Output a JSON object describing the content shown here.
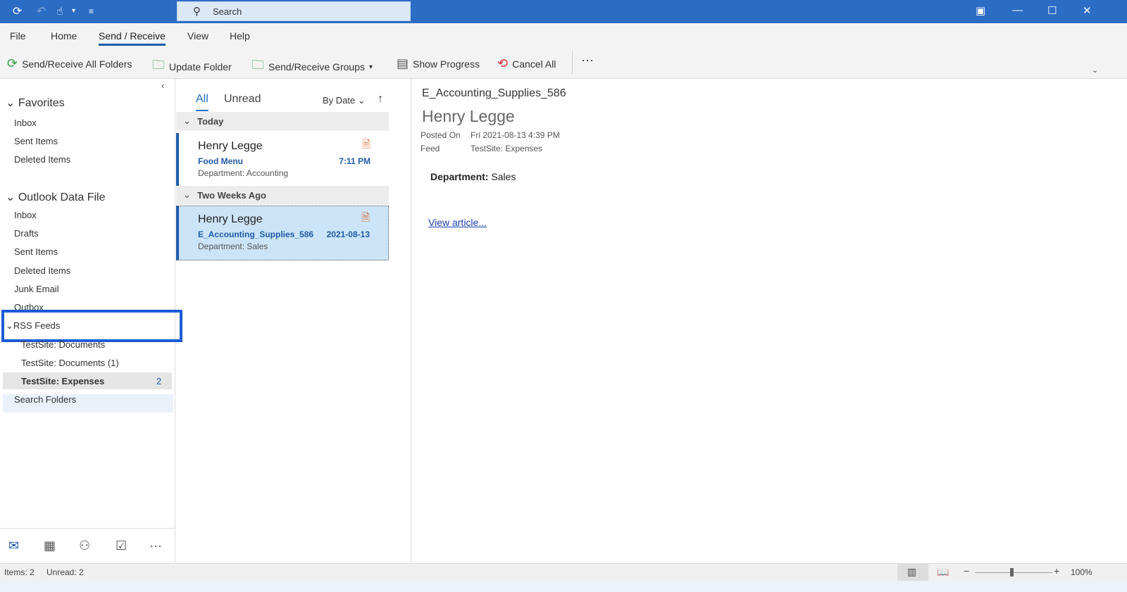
{
  "titlebar": {
    "search_placeholder": "Search",
    "icons": [
      "sync-icon",
      "undo-icon",
      "touch-mode-icon",
      "customize-icon"
    ]
  },
  "menu": {
    "tabs": [
      "File",
      "Home",
      "Send / Receive",
      "View",
      "Help"
    ],
    "active": "Send / Receive"
  },
  "ribbon": {
    "buttons": [
      "Send/Receive All Folders",
      "Update Folder",
      "Send/Receive Groups",
      "Show Progress",
      "Cancel All"
    ],
    "more": "···"
  },
  "nav": {
    "favorites": {
      "label": "Favorites",
      "items": [
        "Inbox",
        "Sent Items",
        "Deleted Items"
      ]
    },
    "datafile": {
      "label": "Outlook Data File",
      "items": [
        "Inbox",
        "Drafts",
        "Sent Items",
        "Deleted Items",
        "Junk Email",
        "Outbox"
      ]
    },
    "rss": {
      "label": "RSS Feeds",
      "items": [
        "TestSite: Documents",
        "TestSite: Documents (1)",
        "TestSite: Expenses"
      ],
      "expenses_unread": "2"
    },
    "search_folders": "Search Folders"
  },
  "list": {
    "tabs": [
      "All",
      "Unread"
    ],
    "sort": "By Date",
    "groups": [
      "Today",
      "Two Weeks Ago"
    ],
    "messages": [
      {
        "from": "Henry Legge",
        "subject": "Food Menu",
        "preview": "Department: Accounting",
        "date": "7:11 PM"
      },
      {
        "from": "Henry Legge",
        "subject": "E_Accounting_Supplies_586",
        "preview": "Department: Sales",
        "date": "2021-08-13"
      }
    ]
  },
  "reader": {
    "subject": "E_Accounting_Supplies_586",
    "from": "Henry Legge",
    "posted_label": "Posted On",
    "posted_value": "Fri 2021-08-13 4:39 PM",
    "feed_label": "Feed",
    "feed_value": "TestSite: Expenses",
    "body_label": "Department:",
    "body_value": "Sales",
    "link": "View article..."
  },
  "status": {
    "items": "Items: 2",
    "unread": "Unread: 2",
    "zoom": "100%",
    "zoom_level": 100
  }
}
